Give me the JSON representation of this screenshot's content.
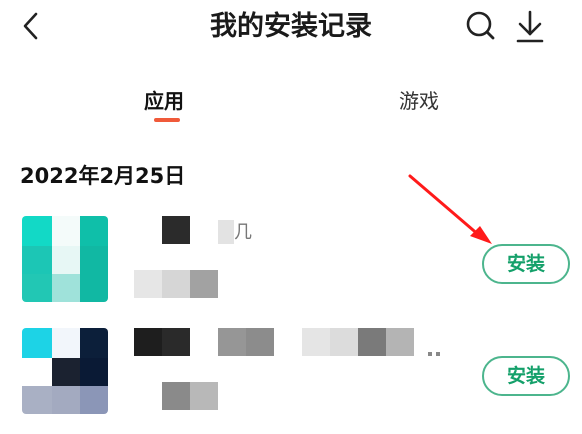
{
  "header": {
    "title": "我的安装记录",
    "back_icon": "chevron-left-icon",
    "search_icon": "search-icon",
    "download_icon": "download-icon"
  },
  "tabs": [
    {
      "label": "应用",
      "selected": true
    },
    {
      "label": "游戏",
      "selected": false
    }
  ],
  "accent_color": "#f05a3a",
  "install_color": "#14a06a",
  "annotation_arrow_color": "#ff1a1a",
  "section": {
    "date": "2022年2月25日",
    "apps": [
      {
        "name_fragment": "几",
        "button_label": "安装"
      },
      {
        "name_fragment": "",
        "button_label": "安装"
      }
    ]
  }
}
